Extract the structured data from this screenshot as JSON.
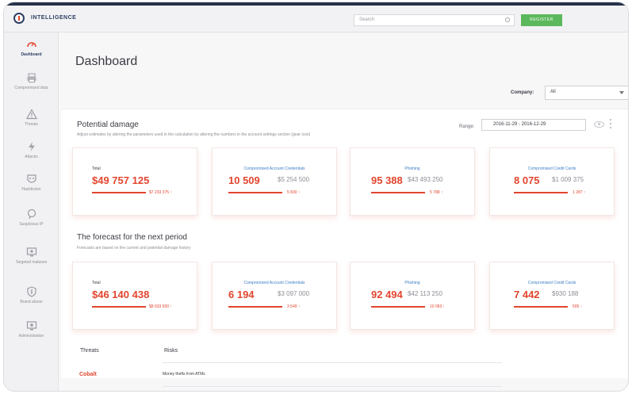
{
  "header": {
    "brand": "INTELLIGENCE",
    "search_placeholder": "Search",
    "register_label": "REGISTER"
  },
  "sidebar": {
    "items": [
      {
        "label": "Dashboard",
        "icon": "gauge-icon",
        "active": true
      },
      {
        "label": "Compromised data",
        "icon": "printer-icon"
      },
      {
        "label": "Threats",
        "icon": "warning-icon"
      },
      {
        "label": "Attacks",
        "icon": "lightning-icon"
      },
      {
        "label": "Hacktivism",
        "icon": "mask-icon"
      },
      {
        "label": "Suspicious IP",
        "icon": "ip-pin-icon"
      },
      {
        "label": "Targeted malware",
        "icon": "monitor-icon"
      },
      {
        "label": "Brand abuse",
        "icon": "shield-icon"
      },
      {
        "label": "Administration",
        "icon": "settings-monitor-icon"
      }
    ]
  },
  "page": {
    "title": "Dashboard",
    "company_label": "Company:",
    "company_value": "All"
  },
  "potential": {
    "title": "Potential damage",
    "subtitle": "Adjust estimates by altering the parameters used in the calculation by altering the numbers in the account settings section (gear icon)",
    "range_label": "Range:",
    "range_value": "2016-11-29 - 2016-12-29",
    "cards": [
      {
        "label": "Total",
        "value": "$49 757 125",
        "cost": "",
        "delta": "$7 233 375 ↑"
      },
      {
        "label": "Compromised Account Credentials",
        "value": "10 509",
        "cost": "$5 254 500",
        "delta": "5 830 ↑"
      },
      {
        "label": "Phishing",
        "value": "95 388",
        "cost": "$43 493 250",
        "delta": "5 788 ↑"
      },
      {
        "label": "Compromised Credit Cards",
        "value": "8 075",
        "cost": "$1 009 375",
        "delta": "1 287 ↑"
      }
    ]
  },
  "forecast": {
    "title": "The forecast for the next period",
    "subtitle": "Forecasts are based on the current and potential damage history",
    "cards": [
      {
        "label": "Total",
        "value": "$46 140 438",
        "cost": "",
        "delta": "$8 633 500 ↑"
      },
      {
        "label": "Compromised Account Credentials",
        "value": "6 194",
        "cost": "$3 097 000",
        "delta": "3 549 ↑"
      },
      {
        "label": "Phishing",
        "value": "92 494",
        "cost": "$42 113 250",
        "delta": "10 063 ↑"
      },
      {
        "label": "Compromised Credit Cards",
        "value": "7 442",
        "cost": "$930 188",
        "delta": "505 ↑"
      }
    ]
  },
  "threats_table": {
    "headers": [
      "Threats",
      "Risks"
    ],
    "rows": [
      {
        "threat": "Cobalt",
        "risk": "Money thefts from ATMs"
      }
    ]
  },
  "colors": {
    "accent": "#e2452e",
    "link": "#3d7fc4",
    "register": "#5cb85c",
    "navy": "#2d3e63"
  }
}
